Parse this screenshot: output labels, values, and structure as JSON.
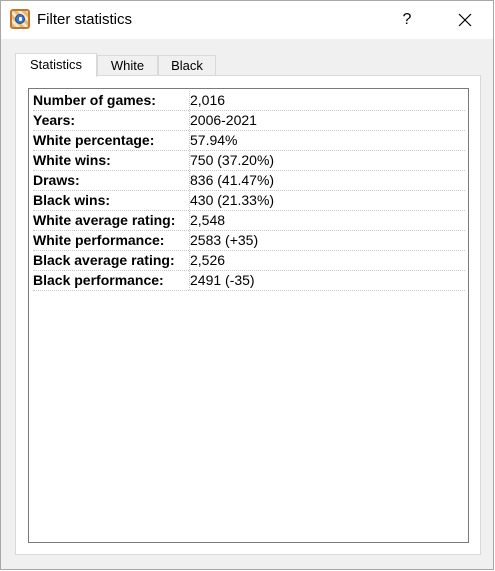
{
  "window": {
    "title": "Filter statistics",
    "help_label": "?"
  },
  "tabs": [
    {
      "label": "Statistics",
      "active": true
    },
    {
      "label": "White",
      "active": false
    },
    {
      "label": "Black",
      "active": false
    }
  ],
  "stats": [
    {
      "label": "Number of games:",
      "value": "2,016"
    },
    {
      "label": "Years:",
      "value": "2006-2021"
    },
    {
      "label": "White percentage:",
      "value": "57.94%"
    },
    {
      "label": "White wins:",
      "value": "750 (37.20%)"
    },
    {
      "label": "Draws:",
      "value": "836 (41.47%)"
    },
    {
      "label": "Black wins:",
      "value": "430 (21.33%)"
    },
    {
      "label": "White average rating:",
      "value": "2,548"
    },
    {
      "label": "White performance:",
      "value": "2583 (+35)"
    },
    {
      "label": "Black average rating:",
      "value": "2,526"
    },
    {
      "label": "Black performance:",
      "value": "2491 (-35)"
    }
  ],
  "icons": {
    "app": "app-icon",
    "close": "close-icon"
  }
}
